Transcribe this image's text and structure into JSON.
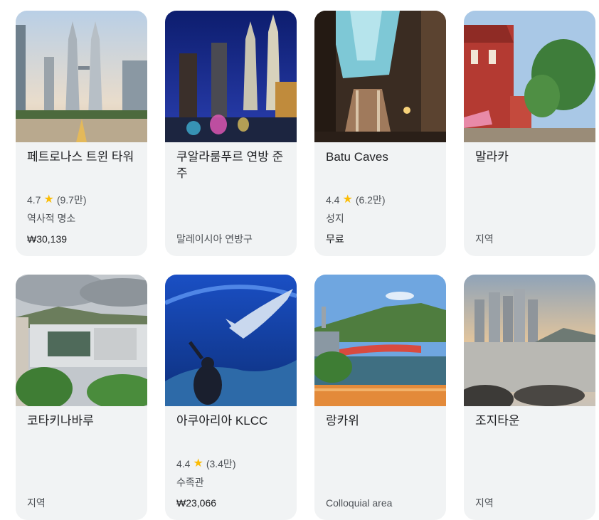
{
  "cards": [
    {
      "title": "페트로나스 트윈 타워",
      "rating": "4.7",
      "reviews": "(9.7만)",
      "category": "역사적 명소",
      "footer": "₩30,139"
    },
    {
      "title": "쿠알라룸푸르 연방 준주",
      "footer": "말레이시아 연방구"
    },
    {
      "title": "Batu Caves",
      "rating": "4.4",
      "reviews": "(6.2만)",
      "category": "성지",
      "footer": "무료"
    },
    {
      "title": "말라카",
      "footer": "지역"
    },
    {
      "title": "코타키나바루",
      "footer": "지역"
    },
    {
      "title": "아쿠아리아 KLCC",
      "rating": "4.4",
      "reviews": "(3.4만)",
      "category": "수족관",
      "footer": "₩23,066"
    },
    {
      "title": "랑카위",
      "footer": "Colloquial area"
    },
    {
      "title": "조지타운",
      "footer": "지역"
    }
  ],
  "colors": {
    "card_bg": "#f1f3f4",
    "star": "#fbbc04",
    "title": "#202124",
    "meta": "#4d5156"
  },
  "icons": {
    "rating": "star-icon"
  }
}
